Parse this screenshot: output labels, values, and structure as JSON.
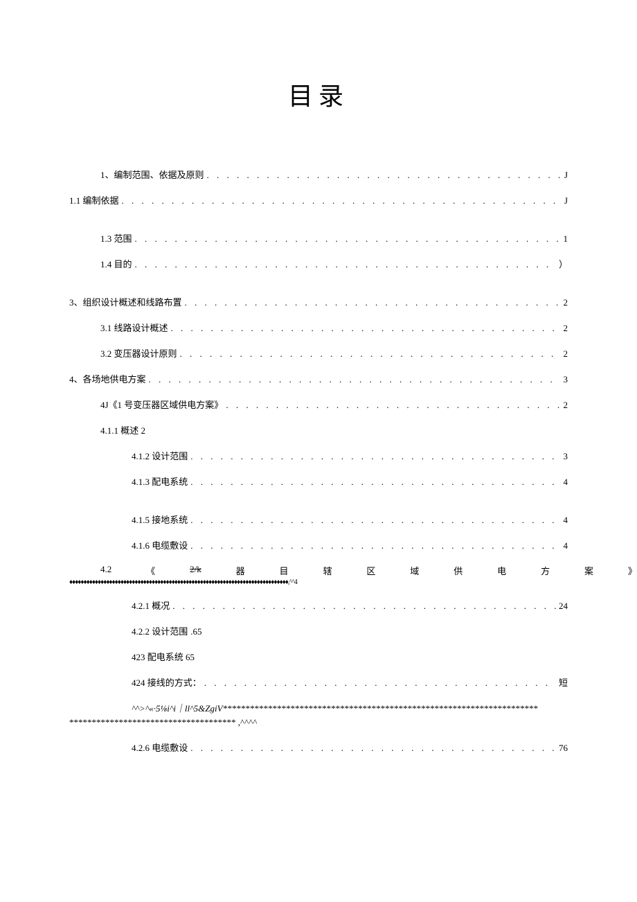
{
  "title": "目录",
  "entries": {
    "e1": {
      "label": "1、编制范围、依据及原则",
      "page": "J"
    },
    "e2": {
      "label": "1.1 编制依据",
      "page": "J"
    },
    "e3": {
      "label": "1.3 范围",
      "page": "1"
    },
    "e4": {
      "label": "1.4 目的",
      "page": "）"
    },
    "e5": {
      "label": "3、组织设计概述和线路布置",
      "page": "2"
    },
    "e6": {
      "label": "3.1 线路设计概述",
      "page": "2"
    },
    "e7": {
      "label": "3.2 变压器设计原则",
      "page": "2"
    },
    "e8": {
      "label": "4、各场地供电方案",
      "page": "3"
    },
    "e9": {
      "label": "4J《1 号变压器区域供电方案》",
      "page": "2"
    },
    "e10": {
      "label": "4.1.1 概述 2"
    },
    "e11": {
      "label": "4.1.2 设计范围",
      "page": "3"
    },
    "e12": {
      "label": "4.1.3 配电系统",
      "page": "4"
    },
    "e13": {
      "label": "4.1.5 接地系统",
      "page": "4"
    },
    "e14": {
      "label": "4.1.6 电缆敷设",
      "page": "4"
    },
    "e15a": "4.2",
    "e15b": "《",
    "e15c": "2/k",
    "e15d": "器",
    "e15e": "目",
    "e15f": "辖",
    "e15g": "区",
    "e15h": "域",
    "e15i": "供",
    "e15j": "电",
    "e15k": "方",
    "e15l": "案",
    "e15m": "》",
    "diamonds": "♦♦♦♦♦♦♦♦♦♦♦♦♦♦♦♦♦♦♦♦♦♦♦♦♦♦♦♦♦♦♦♦♦♦♦♦♦♦♦♦♦♦♦♦♦♦♦♦♦♦♦♦♦♦♦♦♦♦♦♦♦♦♦♦♦♦♦♦♦♦♦♦♦♦♦♦♦,^^4",
    "e16": {
      "label": "4.2.1 概况",
      "page": "24"
    },
    "e17": {
      "label": "4.2.2 设计范围",
      "rest": ".65"
    },
    "e18": {
      "label": "423 配电系统 65"
    },
    "e19": {
      "label": "424 接线的方式：",
      "page": "短"
    },
    "garbled1": "^^>^«·5⅛i^i｜ll^5&ZgiV**********************************************************************",
    "garbled2": "************************************* ,^^^^",
    "e20": {
      "label": "4.2.6 电缆敷设",
      "page": "76"
    }
  },
  "dots": ". . . . . . . . . . . . . . . . . . . . . . . . . . . . . . . . . . . . . . . . . . . . . . . . . . . . . . . . . . . . . . . . . . . . . . . . . . . . . . . . . . . ."
}
